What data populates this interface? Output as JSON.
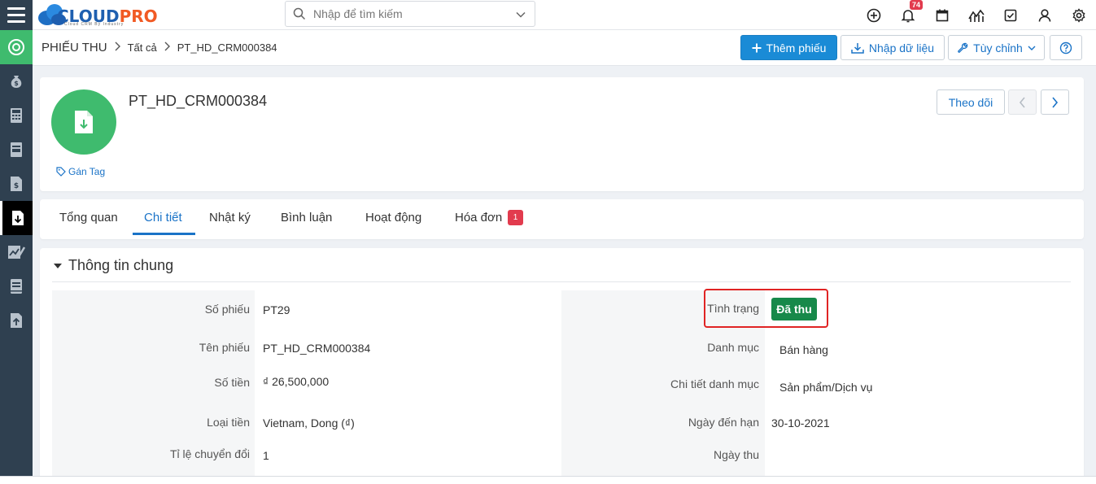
{
  "app": {
    "logo_text_a": "CLOUD",
    "logo_text_b": "PRO",
    "logo_tagline": "Cloud CRM By Industry",
    "brand_blue": "#1e5fb0",
    "brand_orange": "#f15a24"
  },
  "search": {
    "placeholder": "Nhập để tìm kiếm"
  },
  "topbar": {
    "notification_count": "74",
    "icons": [
      "add-circle-icon",
      "bell-icon",
      "calendar-icon",
      "chart-icon",
      "checkbox-icon",
      "user-icon",
      "gear-icon"
    ]
  },
  "sidebar": {
    "items": [
      "target-icon",
      "money-bag-icon",
      "calculator-icon",
      "document-icon",
      "invoice-icon",
      "receipt-download-icon",
      "chart-edit-icon",
      "book-icon",
      "upload-icon"
    ]
  },
  "header": {
    "module": "PHIẾU THU",
    "breadcrumb_all": "Tất cả",
    "breadcrumb_record": "PT_HD_CRM000384",
    "btn_add": "Thêm phiếu",
    "btn_import": "Nhập dữ liệu",
    "btn_customize": "Tùy chỉnh"
  },
  "record": {
    "title": "PT_HD_CRM000384",
    "tag_link": "Gán Tag",
    "follow": "Theo dõi"
  },
  "tabs": [
    {
      "label": "Tổng quan"
    },
    {
      "label": "Chi tiết"
    },
    {
      "label": "Nhật ký"
    },
    {
      "label": "Bình luận"
    },
    {
      "label": "Hoạt động"
    },
    {
      "label": "Hóa đơn",
      "badge": "1"
    }
  ],
  "section": {
    "title": "Thông tin chung",
    "left": [
      {
        "label": "Số phiếu",
        "value": "PT29"
      },
      {
        "label": "Tên phiếu",
        "value": "PT_HD_CRM000384"
      },
      {
        "label": "Số tiền",
        "value": "₫ 26,500,000"
      },
      {
        "label": "Loại tiền",
        "value": "Vietnam, Dong (₫)"
      },
      {
        "label": "Tỉ lệ chuyển đổi",
        "value": "1"
      }
    ],
    "right": [
      {
        "label": "Tình trạng",
        "value": "Đã thu"
      },
      {
        "label": "Danh mục",
        "value": "Bán hàng"
      },
      {
        "label": "Chi tiết danh mục",
        "value": "Sản phẩm/Dịch vụ"
      },
      {
        "label": "Ngày đến hạn",
        "value": "30-10-2021"
      },
      {
        "label": "Ngày thu",
        "value": ""
      }
    ]
  }
}
